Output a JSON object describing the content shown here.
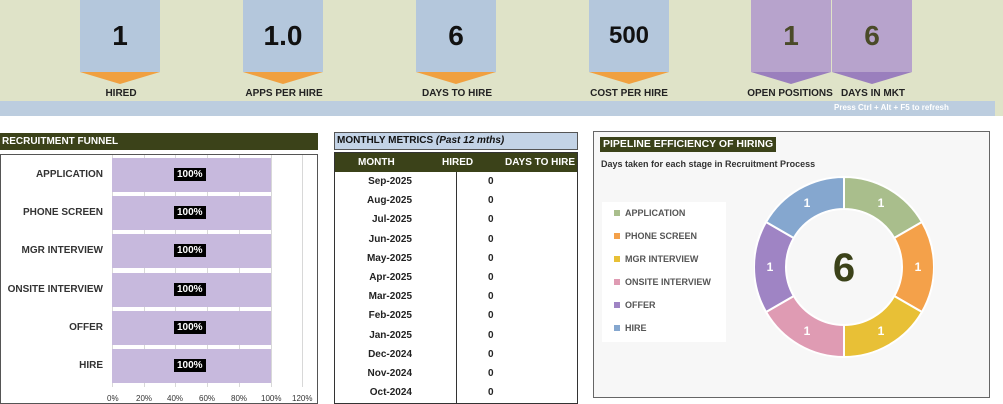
{
  "kpis": {
    "hired": {
      "value": "1",
      "label": "HIRED"
    },
    "apps_per_hire": {
      "value": "1.0",
      "label": "APPS PER HIRE"
    },
    "days_to_hire": {
      "value": "6",
      "label": "DAYS TO HIRE"
    },
    "cost_per_hire": {
      "value": "500",
      "label": "COST PER HIRE"
    },
    "open_positions": {
      "value": "1",
      "label": "OPEN POSITIONS"
    },
    "days_in_mkt": {
      "value": "6",
      "label": "DAYS IN MKT"
    }
  },
  "refresh_hint": "Press Ctrl + Alt + F5 to refresh",
  "colors": {
    "header_dark": "#3b4219",
    "kpi_blue": "#b4c7dc",
    "kpi_purple": "#b7a3cc",
    "arrow_orange": "#f0a040",
    "funnel_bar": "#c7b9dd"
  },
  "funnel": {
    "title": "RECRUITMENT FUNNEL",
    "stages": [
      {
        "label": "APPLICATION",
        "pct": "100%",
        "value": 1.0
      },
      {
        "label": "PHONE SCREEN",
        "pct": "100%",
        "value": 1.0
      },
      {
        "label": "MGR INTERVIEW",
        "pct": "100%",
        "value": 1.0
      },
      {
        "label": "ONSITE INTERVIEW",
        "pct": "100%",
        "value": 1.0
      },
      {
        "label": "OFFER",
        "pct": "100%",
        "value": 1.0
      },
      {
        "label": "HIRE",
        "pct": "100%",
        "value": 1.0
      }
    ],
    "axis_ticks": [
      "0%",
      "20%",
      "40%",
      "60%",
      "80%",
      "100%",
      "120%"
    ]
  },
  "monthly_metrics": {
    "title": "MONTHLY METRICS",
    "subtitle": "(Past 12 mths)",
    "columns": [
      "MONTH",
      "HIRED",
      "DAYS TO HIRE"
    ],
    "rows": [
      {
        "month": "Sep-2025",
        "hired": "0",
        "days": ""
      },
      {
        "month": "Aug-2025",
        "hired": "0",
        "days": ""
      },
      {
        "month": "Jul-2025",
        "hired": "0",
        "days": ""
      },
      {
        "month": "Jun-2025",
        "hired": "0",
        "days": ""
      },
      {
        "month": "May-2025",
        "hired": "0",
        "days": ""
      },
      {
        "month": "Apr-2025",
        "hired": "0",
        "days": ""
      },
      {
        "month": "Mar-2025",
        "hired": "0",
        "days": ""
      },
      {
        "month": "Feb-2025",
        "hired": "0",
        "days": ""
      },
      {
        "month": "Jan-2025",
        "hired": "0",
        "days": ""
      },
      {
        "month": "Dec-2024",
        "hired": "0",
        "days": ""
      },
      {
        "month": "Nov-2024",
        "hired": "0",
        "days": ""
      },
      {
        "month": "Oct-2024",
        "hired": "0",
        "days": ""
      }
    ]
  },
  "pipeline": {
    "title": "PIPELINE EFFICIENCY OF HIRING",
    "subtitle": "Days taken for each stage in Recruitment Process",
    "center_value": "6"
  },
  "chart_data": {
    "type": "pie",
    "categories": [
      "APPLICATION",
      "PHONE SCREEN",
      "MGR INTERVIEW",
      "ONSITE INTERVIEW",
      "OFFER",
      "HIRE"
    ],
    "values": [
      1,
      1,
      1,
      1,
      1,
      1
    ],
    "colors": [
      "#a9be8c",
      "#f4a14a",
      "#e8c036",
      "#df9bb3",
      "#9f84c4",
      "#85a7cf"
    ],
    "legend": "left"
  }
}
